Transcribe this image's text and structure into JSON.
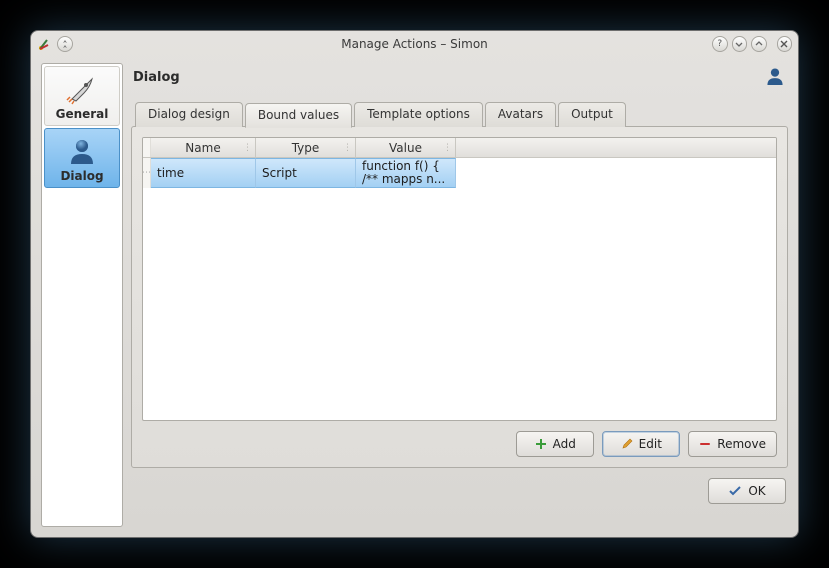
{
  "window": {
    "title": "Manage Actions – Simon"
  },
  "sidebar": {
    "items": [
      {
        "label": "General"
      },
      {
        "label": "Dialog"
      }
    ]
  },
  "heading": "Dialog",
  "tabs": [
    {
      "label": "Dialog design"
    },
    {
      "label": "Bound values"
    },
    {
      "label": "Template options"
    },
    {
      "label": "Avatars"
    },
    {
      "label": "Output"
    }
  ],
  "table": {
    "headers": {
      "name": "Name",
      "type": "Type",
      "value": "Value"
    },
    "rows": [
      {
        "name": "time",
        "type": "Script",
        "value_l1": "function f() {",
        "value_l2": "/** mapps n..."
      }
    ]
  },
  "buttons": {
    "add": "Add",
    "edit": "Edit",
    "remove": "Remove",
    "ok": "OK"
  }
}
